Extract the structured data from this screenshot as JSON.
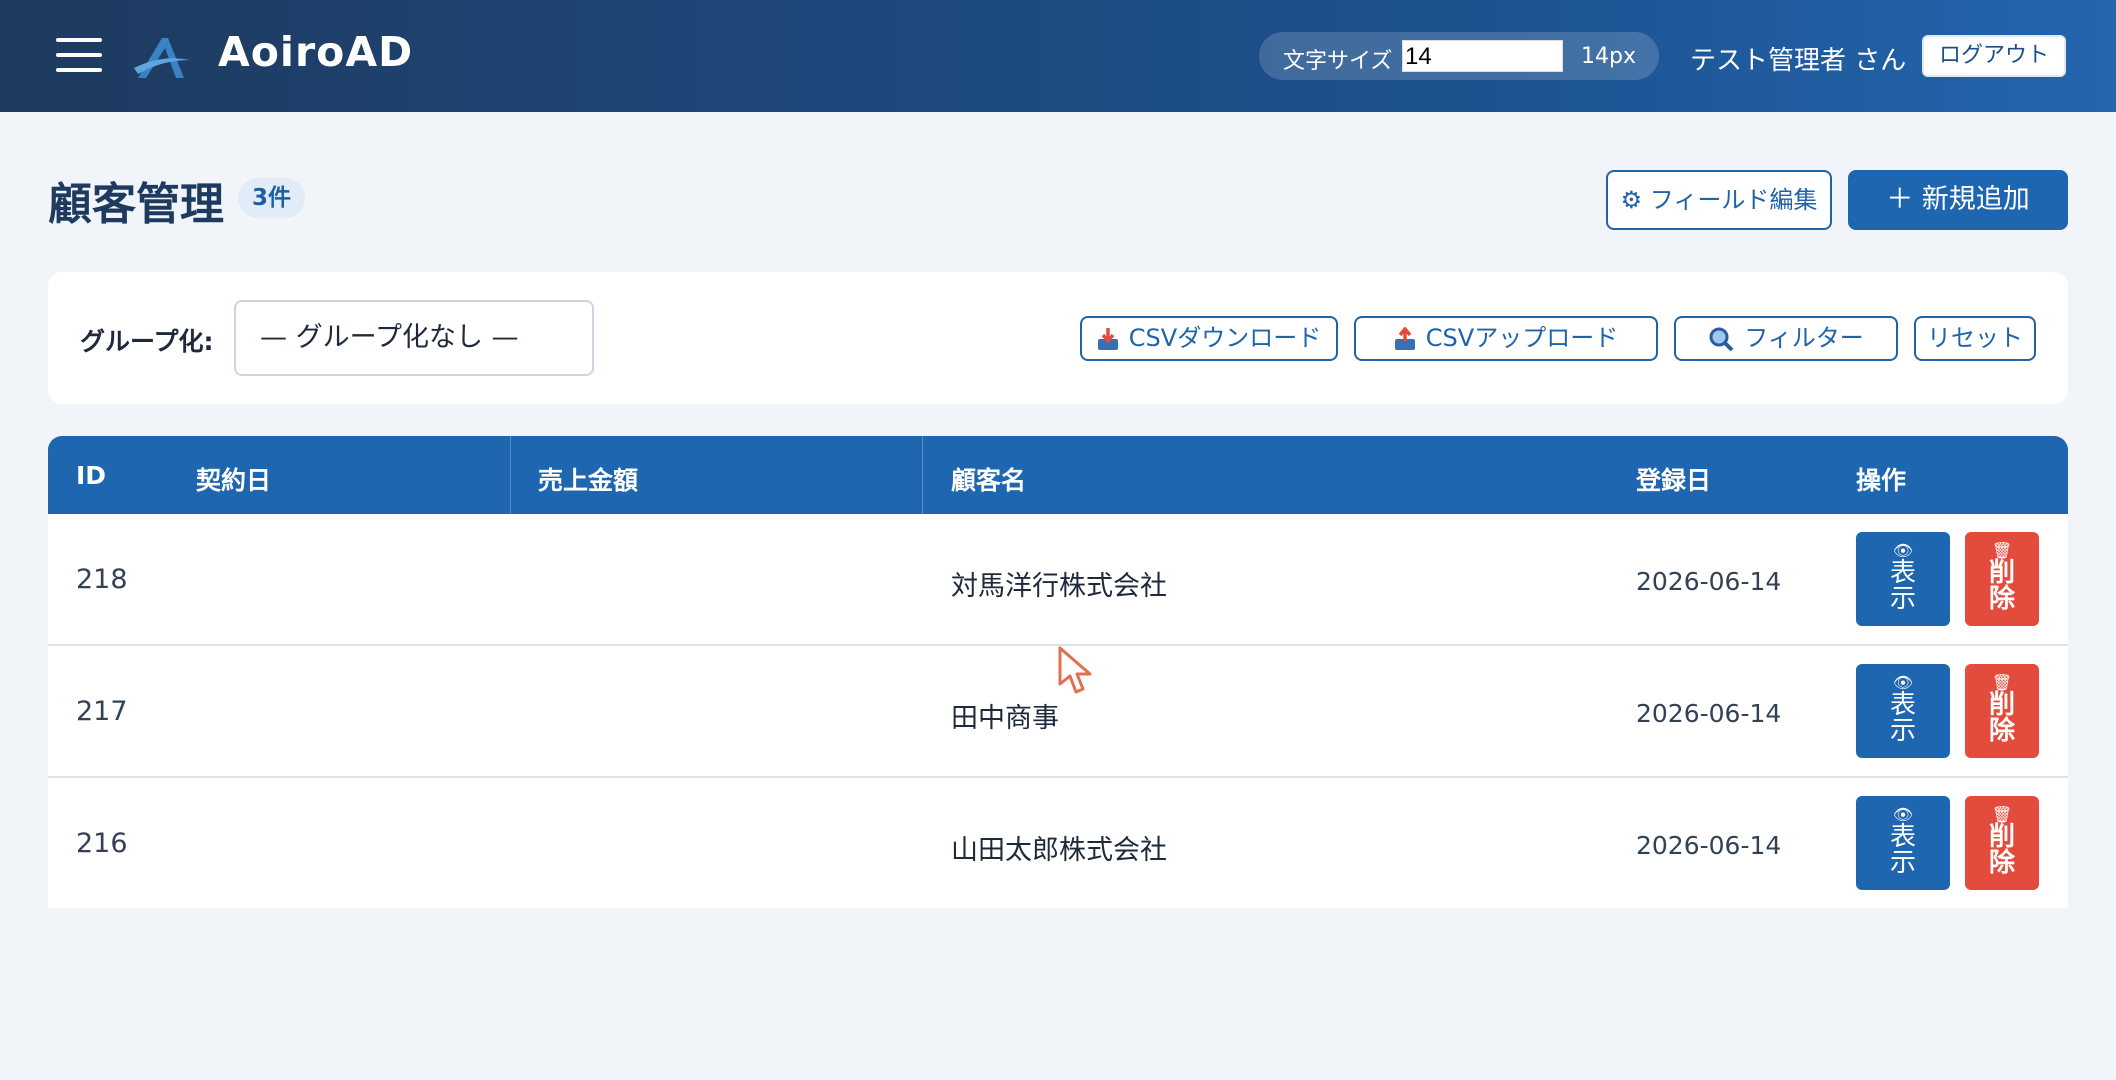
{
  "header": {
    "app_name": "AoiroAD",
    "font_size_label": "文字サイズ",
    "font_size_value": "14",
    "font_size_unit": "14px",
    "user": "テスト管理者 さん",
    "logout_label": "ログアウト"
  },
  "page": {
    "title": "顧客管理",
    "count": "3件",
    "field_edit_label": "⚙ フィールド編集",
    "add_label": "＋ 新規追加"
  },
  "toolbar": {
    "group_label": "グループ化:",
    "group_value": "— グループ化なし —",
    "csv_download_label": "CSVダウンロード",
    "csv_upload_label": "CSVアップロード",
    "filter_label": "フィルター",
    "reset_label": "リセット"
  },
  "table": {
    "columns": [
      "ID",
      "契約日",
      "売上金額",
      "顧客名",
      "登録日",
      "操作"
    ],
    "rows": [
      {
        "id": "218",
        "contract_date": "",
        "sales": "",
        "name": "対馬洋行株式会社",
        "registered": "2026-06-14"
      },
      {
        "id": "217",
        "contract_date": "",
        "sales": "",
        "name": "田中商事",
        "registered": "2026-06-14"
      },
      {
        "id": "216",
        "contract_date": "",
        "sales": "",
        "name": "山田太郎株式会社",
        "registered": "2026-06-14"
      }
    ],
    "view_label": "表示",
    "delete_label": "削除"
  },
  "icons": {
    "menu": "hamburger-icon",
    "logo": "aoiro-logo-icon",
    "download": "download-icon",
    "upload": "upload-icon",
    "filter": "magnifier-icon",
    "view": "eye-icon",
    "delete": "trash-icon"
  },
  "colors": {
    "primary": "#1f66b0",
    "danger": "#e34c3c",
    "header_dark": "#1e3a5f",
    "background": "#f1f5f9"
  }
}
